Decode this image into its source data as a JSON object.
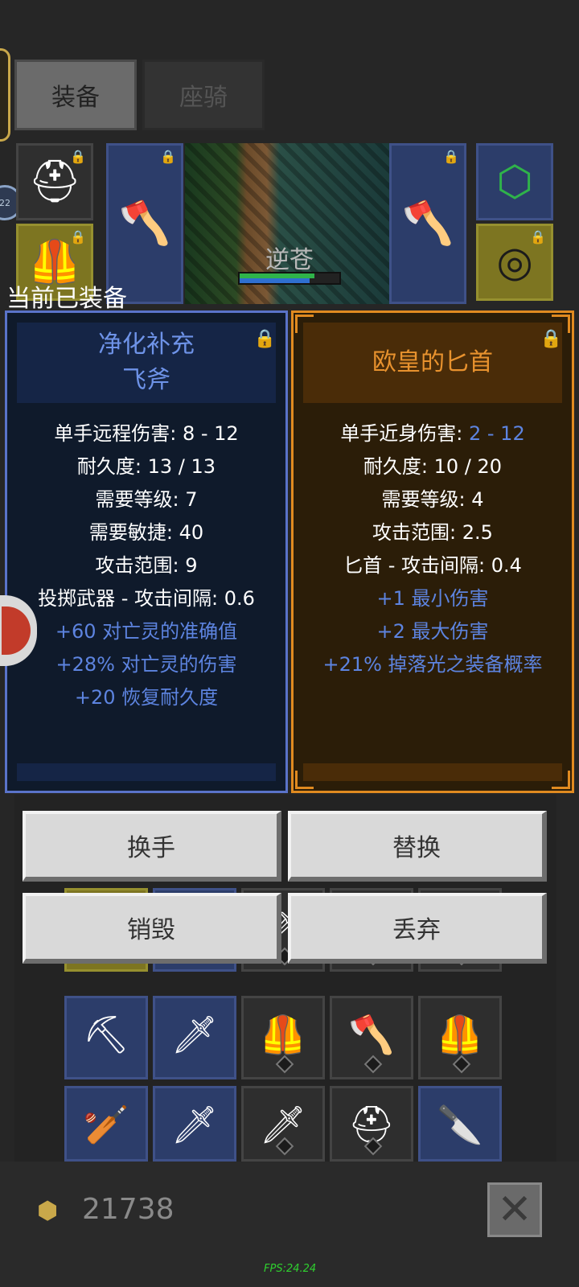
{
  "tabs": [
    {
      "label": "装备",
      "active": true
    },
    {
      "label": "座骑",
      "active": false
    }
  ],
  "hero": {
    "name": "逆苍",
    "hp_fraction": 0.75,
    "mp_fraction": 0.7
  },
  "side_badge": "22",
  "equipped_label": "当前已装备",
  "equipped_item": {
    "title_line1": "净化补充",
    "title_line2": "飞斧",
    "stats": [
      {
        "text": "单手远程伤害: 8 - 12",
        "color": "white"
      },
      {
        "text": "耐久度: 13 / 13",
        "color": "white"
      },
      {
        "text": "需要等级: 7",
        "color": "white"
      },
      {
        "text": "需要敏捷: 40",
        "color": "white"
      },
      {
        "text": "攻击范围: 9",
        "color": "white"
      },
      {
        "text": "投掷武器 - 攻击间隔: 0.6",
        "color": "white"
      },
      {
        "text": "+60 对亡灵的准确值",
        "color": "blue"
      },
      {
        "text": "+28% 对亡灵的伤害",
        "color": "blue"
      },
      {
        "text": "+20 恢复耐久度",
        "color": "blue"
      }
    ]
  },
  "compare_item": {
    "title": "欧皇的匕首",
    "stats": [
      {
        "label": "单手近身伤害: ",
        "value": "2 - 12"
      },
      {
        "text": "耐久度: 10 / 20",
        "color": "white"
      },
      {
        "text": "需要等级: 4",
        "color": "white"
      },
      {
        "text": "攻击范围: 2.5",
        "color": "white"
      },
      {
        "text": "匕首 - 攻击间隔: 0.4",
        "color": "white"
      },
      {
        "text": "+1 最小伤害",
        "color": "blue"
      },
      {
        "text": "+2 最大伤害",
        "color": "blue"
      },
      {
        "text": "+21% 掉落光之装备概率",
        "color": "blue"
      }
    ]
  },
  "buttons": {
    "swap_hand": "换手",
    "replace": "替换",
    "destroy": "销毁",
    "discard": "丢弃"
  },
  "currency": {
    "amount": "21738"
  },
  "fps": "FPS:24.24",
  "colors": {
    "magic_blue": "#5d84e0",
    "legend_orange": "#e8922e",
    "fps_green": "#2fcf2f"
  }
}
